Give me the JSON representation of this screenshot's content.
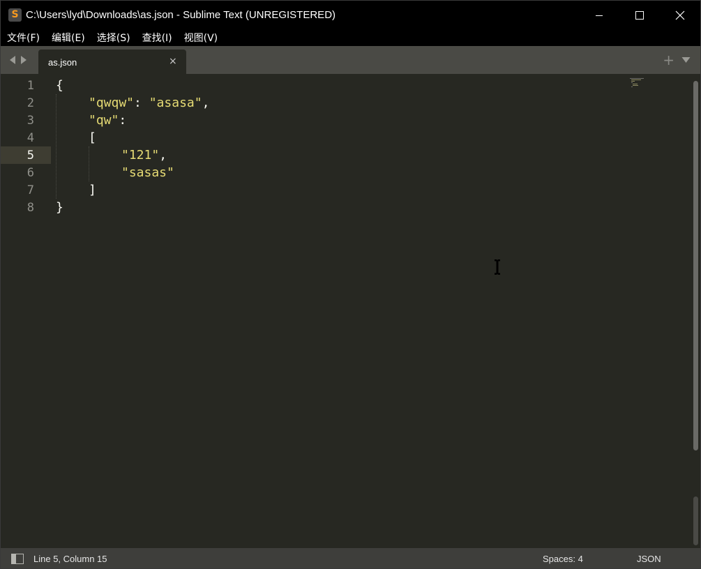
{
  "window": {
    "title": "C:\\Users\\lyd\\Downloads\\as.json - Sublime Text (UNREGISTERED)",
    "app_icon_glyph": "S",
    "controls": {
      "minimize_icon": "minimize-icon",
      "maximize_icon": "maximize-icon",
      "close_icon": "close-icon"
    }
  },
  "menu": {
    "items": [
      {
        "label": "文件(F)"
      },
      {
        "label": "编辑(E)"
      },
      {
        "label": "选择(S)"
      },
      {
        "label": "查找(I)"
      },
      {
        "label": "视图(V)"
      }
    ]
  },
  "tabs": {
    "items": [
      {
        "label": "as.json",
        "active": true,
        "close_glyph": "×"
      }
    ],
    "new_tab_glyph": "+"
  },
  "editor": {
    "active_line": 5,
    "lines": [
      {
        "number": "1"
      },
      {
        "number": "2"
      },
      {
        "number": "3"
      },
      {
        "number": "4"
      },
      {
        "number": "5"
      },
      {
        "number": "6"
      },
      {
        "number": "7"
      },
      {
        "number": "8"
      }
    ],
    "tokens": {
      "l1_brace": "{",
      "l2_key": "\"qwqw\"",
      "l2_colon": ": ",
      "l2_value": "\"asasa\"",
      "l2_comma": ",",
      "l3_key": "\"qw\"",
      "l3_colon": ":",
      "l4_bracket": "[",
      "l5_value": "\"121\"",
      "l5_comma": ",",
      "l6_value": "\"sasas\"",
      "l7_bracket": "]",
      "l8_brace": "}"
    }
  },
  "status": {
    "position": "Line 5, Column 15",
    "indentation": "Spaces: 4",
    "syntax": "JSON"
  },
  "colors": {
    "background": "#272822",
    "string": "#e6db74",
    "text": "#f8f8f2",
    "line_highlight": "#3e3d32",
    "tabbar": "#4a4a45",
    "statusbar": "#3e3e3b",
    "titlebar": "#000000"
  }
}
